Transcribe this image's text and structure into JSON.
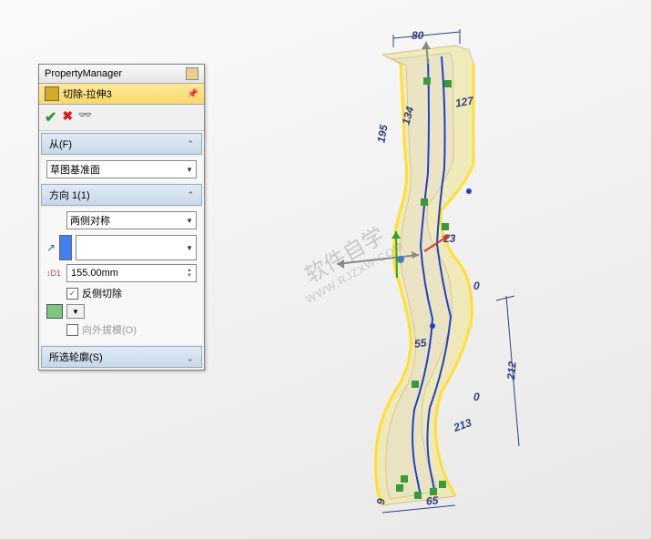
{
  "panel": {
    "title": "PropertyManager",
    "feature_name": "切除-拉伸3",
    "sections": {
      "from": {
        "label": "从(F)",
        "value": "草图基准面"
      },
      "direction": {
        "label": "方向 1(1)",
        "end_condition": "两侧对称",
        "depth": "155.00mm",
        "flip_side": "反侧切除",
        "flip_checked": true,
        "draft_outward": "向外拔模(O)",
        "draft_checked": false
      },
      "contours": {
        "label": "所选轮廓(S)"
      }
    }
  },
  "dimensions": {
    "d80": "80",
    "d134": "134",
    "d195": "195",
    "d127": "127",
    "d23": "23",
    "d55": "55",
    "d212": "212",
    "d213": "213",
    "d65": "65",
    "d9": "9",
    "d0": "0"
  },
  "watermark": {
    "cn": "软件自学",
    "url": "WWW.RJZXW.COM"
  }
}
